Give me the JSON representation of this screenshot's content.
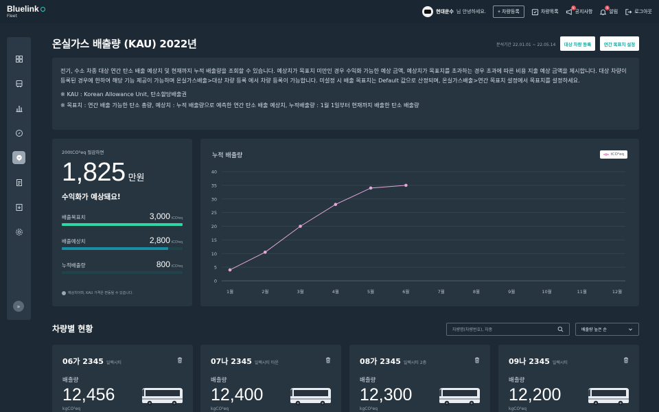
{
  "header": {
    "logo": "Bluelink",
    "logo_sub": "Fleet",
    "user_name": "현대운수",
    "greeting": "님 안녕하세요.",
    "register_button": "+ 차량등록",
    "nav": [
      {
        "label": "차량목록",
        "icon": "vehicle-list-icon",
        "badge": ""
      },
      {
        "label": "공지사항",
        "icon": "megaphone-icon",
        "badge": "N"
      },
      {
        "label": "알림",
        "icon": "bell-icon",
        "badge": "N"
      },
      {
        "label": "로그아웃",
        "icon": "logout-icon",
        "badge": ""
      }
    ]
  },
  "sidebar": {
    "items": [
      {
        "icon": "dashboard-grid-icon",
        "active": false
      },
      {
        "icon": "bus-icon",
        "active": false
      },
      {
        "icon": "bar-chart-icon",
        "active": false
      },
      {
        "icon": "compass-icon",
        "active": false
      },
      {
        "icon": "leaf-icon",
        "active": true
      },
      {
        "icon": "document-icon",
        "active": false
      },
      {
        "icon": "download-icon",
        "active": false
      },
      {
        "icon": "settings-icon",
        "active": false
      }
    ],
    "expand_icon": "double-chevron-right-icon"
  },
  "page": {
    "title": "온실가스 배출량 (KAU) 2022년",
    "period": "분석기간 22.01.01 ~ 22.05.14",
    "btn_target_vehicle": "대상 차량 등록",
    "btn_annual_target": "연간 목표치 설정"
  },
  "info": {
    "description": "전기, 수소 차종 대상 연간 탄소 배출 예상치 및 현재까지 누적 배출량을 조회할 수 있습니다. 예상치가 목표치 미만인 경우 수익화 가능한 예상 금액, 예상치가 목표치를 초과하는 경우 초과에 따른 비용 지출 예상 금액을 제시합니다. 대상 차량이 등록된 경우에 한하여 해당 기능 제공이 가능하며 온실가스배출>대상 차량 등록 에서 차량 등록이 가능합니다. 미설정 시 배출 목표치는 Default 값으로 산정되며, 온실가스배출>연간 목표치 설정에서 목표치를 설정하세요.",
    "note1": "※ KAU : Korean Allowance Unit, 탄소할당배출권",
    "note2": "※ 목표치 : 연간 배출 가능한 탄소 총량, 예상치 : 누적 배출량으로 예측한 연간 탄소 배출 예상치, 누적배출량 : 1월 1일부터 현재까지 배출한 탄소 배출량"
  },
  "kpi": {
    "sub": "200tCO²eq 절감하면",
    "amount": "1,825",
    "amount_unit": "만원",
    "message": "수익화가 예상돼요!",
    "unit": "tCO²eq",
    "bars": [
      {
        "label": "배출목표치",
        "value": "3,000",
        "fill": 1.0,
        "color": "#2fd6a6"
      },
      {
        "label": "배출예상치",
        "value": "2,800",
        "fill": 0.88,
        "color": "#1a8fa4"
      },
      {
        "label": "누적배출량",
        "value": "800",
        "fill": 0.0,
        "color": "#1a8fa4"
      }
    ],
    "footnote": "예상치이며, KAU 가격은 변동될 수 있습니다."
  },
  "chart_data": {
    "type": "line",
    "title": "누적 배출량",
    "legend": "tCO²eq",
    "categories": [
      "1월",
      "2월",
      "3월",
      "4월",
      "5월",
      "6월",
      "7월",
      "8월",
      "9월",
      "10월",
      "11월",
      "12월"
    ],
    "series": [
      {
        "name": "tCO²eq",
        "color": "#e4a7d8",
        "values": [
          4,
          10.5,
          20,
          28,
          34,
          35
        ]
      }
    ],
    "ylim": [
      0,
      40
    ],
    "yticks": [
      0,
      5,
      10,
      15,
      20,
      25,
      30,
      35,
      40
    ],
    "grid": true
  },
  "vehicles": {
    "title": "차량별 현황",
    "search_placeholder": "차량명(차량번호), 차종",
    "sort_label": "배출량 높은 순",
    "label": "배출량",
    "unit": "kgCO²eq",
    "items": [
      {
        "plate": "06가 2345",
        "model": "일렉시티",
        "value": "12,456"
      },
      {
        "plate": "07나 2345",
        "model": "일렉시티 타운",
        "value": "12,400"
      },
      {
        "plate": "08가 2345",
        "model": "일렉시티 2층",
        "value": "12,300"
      },
      {
        "plate": "09나 2345",
        "model": "일렉시티",
        "value": "12,200"
      }
    ]
  }
}
